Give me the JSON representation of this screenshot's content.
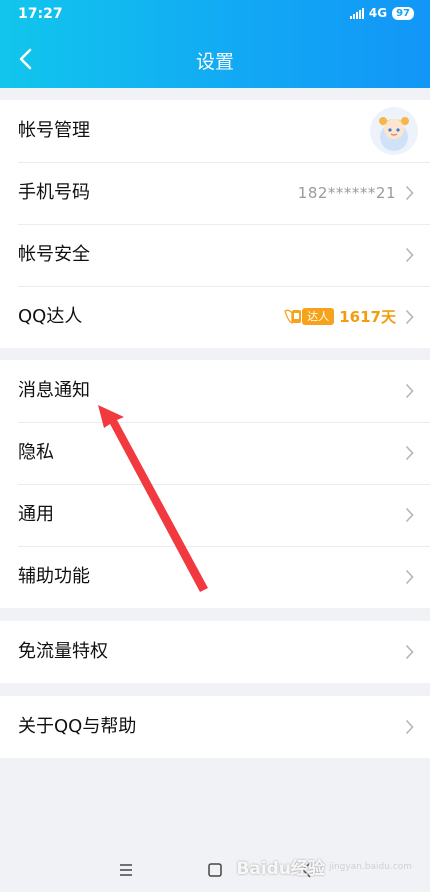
{
  "status_bar": {
    "time": "17:27",
    "network": "4G",
    "battery": "97"
  },
  "header": {
    "title": "设置"
  },
  "sections": [
    {
      "items": [
        {
          "label": "帐号管理"
        },
        {
          "label": "手机号码",
          "value": "182******21"
        },
        {
          "label": "帐号安全"
        },
        {
          "label": "QQ达人",
          "badge": "达人",
          "days": "1617天"
        }
      ]
    },
    {
      "items": [
        {
          "label": "消息通知"
        },
        {
          "label": "隐私"
        },
        {
          "label": "通用"
        },
        {
          "label": "辅助功能"
        }
      ]
    },
    {
      "items": [
        {
          "label": "免流量特权"
        }
      ]
    },
    {
      "items": [
        {
          "label": "关于QQ与帮助"
        }
      ]
    }
  ],
  "annotation": {
    "color": "#f2393f"
  },
  "theme": {
    "header_start": "#11c6ec",
    "header_end": "#1296f7",
    "talent": "#f7a21b"
  },
  "watermark": {
    "text": "Baidu经验",
    "sub": "jingyan.baidu.com"
  }
}
